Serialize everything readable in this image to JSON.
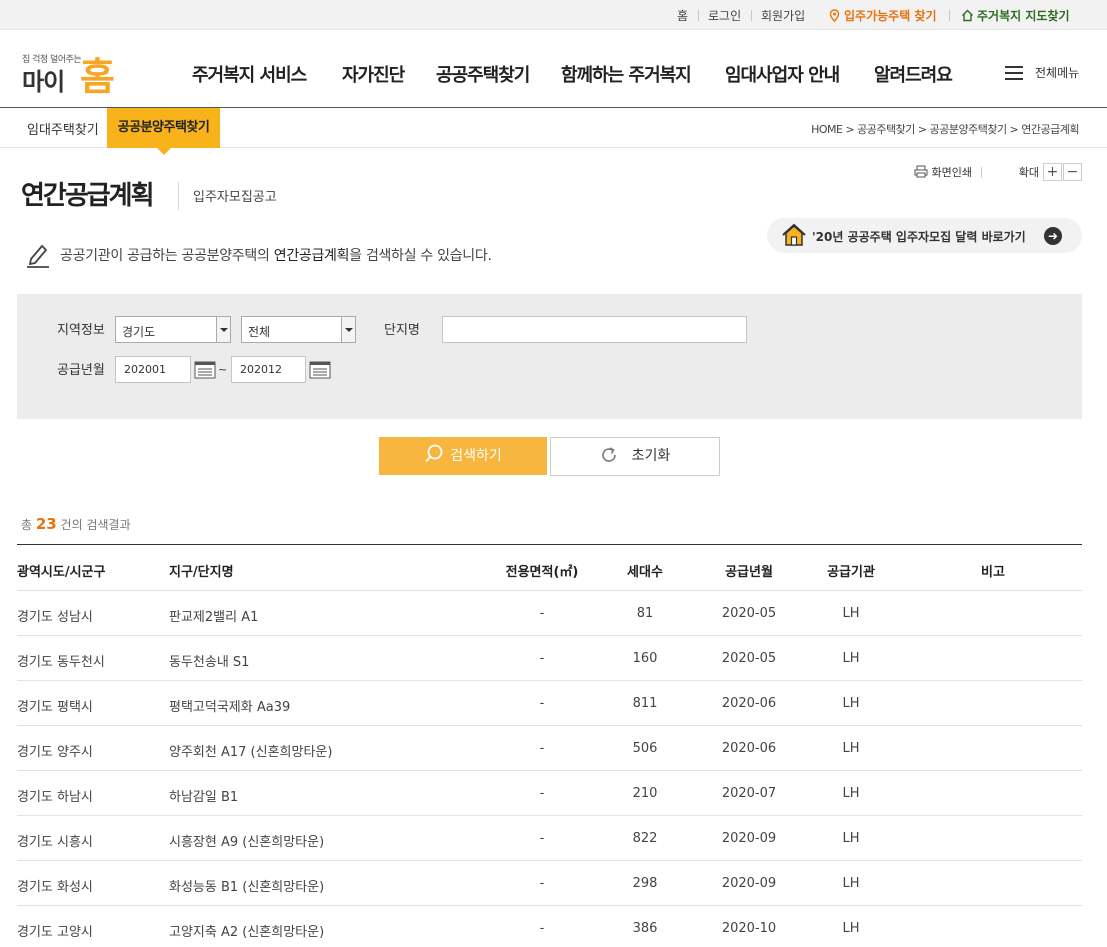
{
  "utility": {
    "home": "홈",
    "login": "로그인",
    "signup": "회원가입",
    "find_housing": "입주가능주택 찾기",
    "map_search": "주거복지 지도찾기"
  },
  "logo": {
    "tagline": "집 걱정 덜어주는",
    "name_left": "마이",
    "name_right": "홈"
  },
  "gnb": {
    "items": [
      "주거복지 서비스",
      "자가진단",
      "공공주택찾기",
      "함께하는 주거복지",
      "임대사업자 안내",
      "알려드려요"
    ],
    "all_menu": "전체메뉴"
  },
  "subnav": {
    "tab_rental": "임대주택찾기",
    "tab_sale": "공공분양주택찾기",
    "breadcrumb": "HOME > 공공주택찾기 > 공공분양주택찾기 > 연간공급계획"
  },
  "tools": {
    "print": "화면인쇄",
    "zoom": "확대",
    "zoom_in": "+",
    "zoom_out": "−"
  },
  "page": {
    "title": "연간공급계획",
    "subtitle": "입주자모집공고",
    "calendar_link": "'20년 공공주택 입주자모집 달력 바로가기",
    "description_pre": "공공기관이 공급하는 공공분양주택의 ",
    "description_bold": "연간공급계획",
    "description_post": "을 검색하실 수 있습니다."
  },
  "search": {
    "region_label": "지역정보",
    "region_value": "경기도",
    "district_value": "전체",
    "complex_label": "단지명",
    "complex_value": "",
    "period_label": "공급년월",
    "from_value": "202001",
    "to_value": "202012",
    "tilde": "~",
    "search_button": "검색하기",
    "reset_button": "초기화"
  },
  "result": {
    "prefix": "총 ",
    "count": "23",
    "suffix": " 건의 검색결과"
  },
  "table": {
    "headers": [
      "광역시도/시군구",
      "지구/단지명",
      "전용면적(㎡)",
      "세대수",
      "공급년월",
      "공급기관",
      "비고"
    ],
    "rows": [
      [
        "경기도 성남시",
        "판교제2밸리 A1",
        "-",
        "81",
        "2020-05",
        "LH",
        ""
      ],
      [
        "경기도 동두천시",
        "동두천송내 S1",
        "-",
        "160",
        "2020-05",
        "LH",
        ""
      ],
      [
        "경기도 평택시",
        "평택고덕국제화 Aa39",
        "-",
        "811",
        "2020-06",
        "LH",
        ""
      ],
      [
        "경기도 양주시",
        "양주회천 A17 (신혼희망타운)",
        "-",
        "506",
        "2020-06",
        "LH",
        ""
      ],
      [
        "경기도 하남시",
        "하남감일 B1",
        "-",
        "210",
        "2020-07",
        "LH",
        ""
      ],
      [
        "경기도 시흥시",
        "시흥장현 A9 (신혼희망타운)",
        "-",
        "822",
        "2020-09",
        "LH",
        ""
      ],
      [
        "경기도 화성시",
        "화성능동 B1 (신혼희망타운)",
        "-",
        "298",
        "2020-09",
        "LH",
        ""
      ],
      [
        "경기도 고양시",
        "고양지축 A2 (신혼희망타운)",
        "-",
        "386",
        "2020-10",
        "LH",
        ""
      ]
    ]
  },
  "colors": {
    "accent": "#f7b319",
    "button": "#f7b63f",
    "highlight": "#e8720c",
    "green": "#2d6b22"
  }
}
